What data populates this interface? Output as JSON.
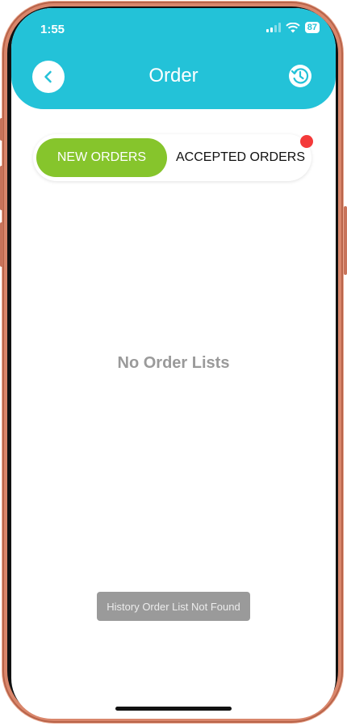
{
  "status_bar": {
    "time": "1:55",
    "battery": "87",
    "icons": [
      "signal-icon",
      "wifi-icon",
      "battery-icon"
    ]
  },
  "header": {
    "title": "Order",
    "back_icon": "chevron-left-icon",
    "history_icon": "history-clock-icon",
    "background_color": "#23c2d8"
  },
  "tabs": [
    {
      "label": "NEW ORDERS",
      "active": true,
      "color": "#86c52c"
    },
    {
      "label": "ACCEPTED ORDERS",
      "active": false,
      "has_notification_dot": true,
      "dot_color": "#f43a3a"
    }
  ],
  "empty_state": {
    "text": "No Order Lists"
  },
  "toast": {
    "text": "History Order List Not Found"
  }
}
